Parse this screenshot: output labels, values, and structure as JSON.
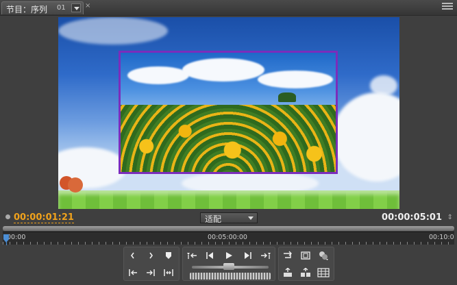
{
  "panel": {
    "tab_label": "节目：序列",
    "sequence_number": "01",
    "close_glyph": "×",
    "menu_icon": "panel-menu-icon"
  },
  "timecode": {
    "current": "00:00:01:21",
    "duration": "00:00:05:01"
  },
  "zoom_select": {
    "selected": "适配"
  },
  "ruler": {
    "labels": [
      "00:00",
      "00:05:00:00",
      "00:10:0"
    ]
  },
  "playhead_position": 0,
  "controls": {
    "group1": [
      "mark-in-icon",
      "mark-out-icon",
      "set-marker-icon",
      "go-to-in-icon",
      "insert-icon",
      "go-to-out-icon"
    ],
    "transport": [
      "go-to-in-point-icon",
      "step-back-icon",
      "play-icon",
      "step-forward-icon",
      "go-to-out-point-icon"
    ],
    "group3": [
      "loop-icon",
      "safe-margins-icon",
      "output-icon",
      "lift-icon",
      "extract-icon",
      "export-frame-icon"
    ]
  },
  "colors": {
    "current_timecode": "#f0a21c",
    "playhead": "#4c8fd6",
    "inset_border": "#7b2dbb"
  }
}
